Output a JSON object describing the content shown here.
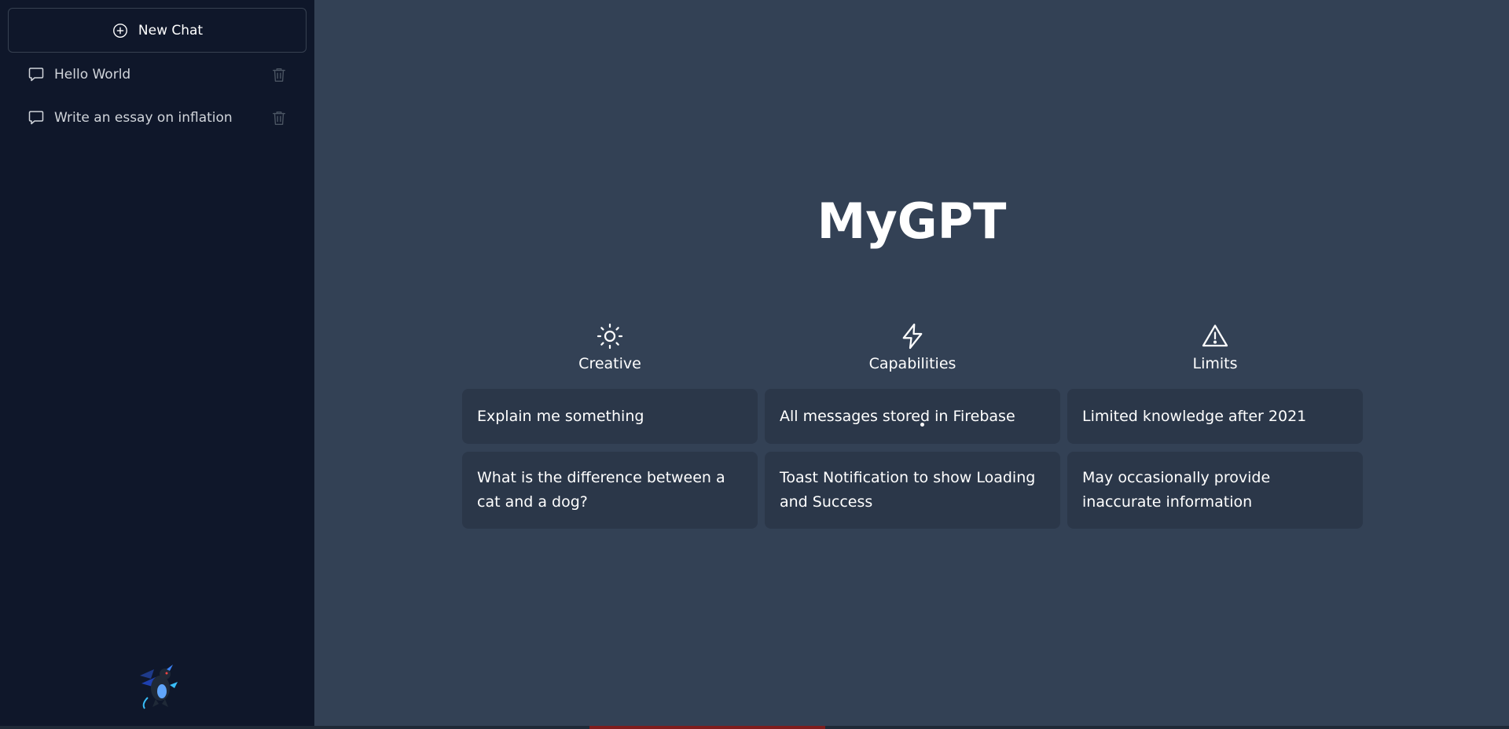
{
  "sidebar": {
    "new_chat_label": "New Chat",
    "chats": [
      {
        "label": "Hello World"
      },
      {
        "label": "Write an essay on inflation"
      }
    ]
  },
  "main": {
    "title": "MyGPT",
    "columns": [
      {
        "icon": "sun-icon",
        "title": "Creative",
        "cards": [
          "Explain me something",
          "What is the difference between a cat and a dog?"
        ]
      },
      {
        "icon": "bolt-icon",
        "title": "Capabilities",
        "cards": [
          "All messages stored in Firebase",
          "Toast Notification to show Loading and Success"
        ]
      },
      {
        "icon": "warning-triangle-icon",
        "title": "Limits",
        "cards": [
          "Limited knowledge after 2021",
          "May occasionally provide inaccurate information"
        ]
      }
    ]
  },
  "colors": {
    "sidebar_bg": "#0f172a",
    "main_bg": "#334155",
    "card_bg": "#2b3749",
    "text": "#ffffff",
    "muted_icon": "#4b5563"
  }
}
